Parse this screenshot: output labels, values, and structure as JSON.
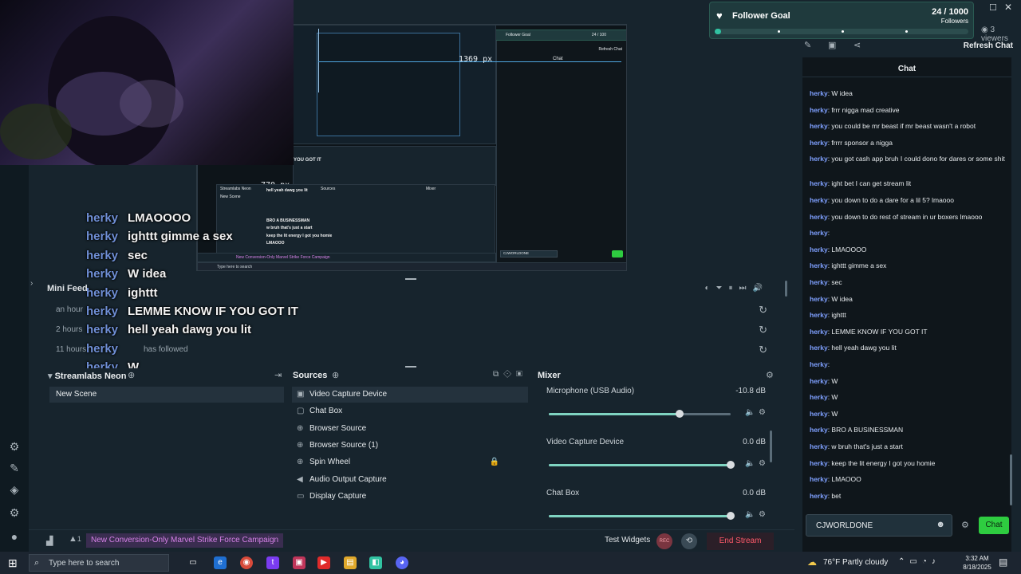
{
  "window": {
    "viewers": "3 viewers"
  },
  "follower_goal": {
    "title": "Follower Goal",
    "count": "24 / 1000",
    "unit": "Followers",
    "progress": 0.024
  },
  "preview": {
    "width_readout": "1369 px",
    "height_readout": "770 px",
    "inner_overlay_line_1": "hell yeah dawg you lit",
    "inner_overlay_line_2": "BRO A BUSINESSMAN",
    "inner_overlay_line_3": "w bruh that's just a start",
    "inner_overlay_line_4": "keep the lit energy I got you homie",
    "inner_overlay_line_5": "LMAOOO",
    "inner_feed_text": "YOU GOT IT",
    "inner_chat_title": "Chat",
    "inner_goal_title": "Follower Goal",
    "inner_goal_count": "24 / 100",
    "inner_refresh": "Refresh Chat",
    "inner_scene": "Streamlabs Neon",
    "inner_new_scene": "New Scene",
    "inner_sources": "Sources",
    "inner_mixer": "Mixer",
    "inner_campaign": "New Conversion-Only Marvel Strike Force Campaign",
    "inner_input": "CJWORLDONE",
    "inner_taskbar_search": "Type here to search"
  },
  "chat_overlay": [
    {
      "user": "herky",
      "msg": "LMAOOOO"
    },
    {
      "user": "herky",
      "msg": "ighttt gimme a sex"
    },
    {
      "user": "herky",
      "msg": "sec"
    },
    {
      "user": "herky",
      "msg": "W idea"
    },
    {
      "user": "herky",
      "msg": "ighttt"
    },
    {
      "user": "herky",
      "msg": "LEMME KNOW IF YOU GOT IT"
    },
    {
      "user": "herky",
      "msg": "hell yeah dawg you lit"
    },
    {
      "user": "herky",
      "msg": ""
    },
    {
      "user": "herky",
      "msg": "W"
    },
    {
      "user": "herky",
      "msg": "W"
    },
    {
      "user": "herky",
      "msg": "W"
    },
    {
      "user": "herky",
      "msg": "BRO A BUSINESSMAN"
    },
    {
      "user": "herky",
      "msg": "w bruh that's just a start"
    },
    {
      "user": "herky",
      "msg": "keep the lit energy I got you\nhomie"
    },
    {
      "user": "herky",
      "msg": "LMAOOO"
    },
    {
      "user": "herky",
      "msg": "bet"
    }
  ],
  "mini_feed": {
    "title": "Mini Feed",
    "rows": [
      {
        "time": "an hour",
        "user": "",
        "action": ""
      },
      {
        "time": "2 hours",
        "user": "",
        "action": ""
      },
      {
        "time": "11 hours",
        "user": "",
        "action": "has followed"
      }
    ]
  },
  "scenes": {
    "title": "Streamlabs Neon",
    "items": [
      "New Scene"
    ]
  },
  "sources": {
    "title": "Sources",
    "items": [
      {
        "label": "Video Capture Device",
        "icon": "video-icon"
      },
      {
        "label": "Chat Box",
        "icon": "chat-icon"
      },
      {
        "label": "Browser Source",
        "icon": "globe-icon"
      },
      {
        "label": "Browser Source (1)",
        "icon": "globe-icon"
      },
      {
        "label": "Spin Wheel",
        "icon": "globe-icon"
      },
      {
        "label": "Audio Output Capture",
        "icon": "speaker-icon"
      },
      {
        "label": "Display Capture",
        "icon": "monitor-icon"
      }
    ]
  },
  "mixer": {
    "title": "Mixer",
    "channels": [
      {
        "name": "Microphone (USB Audio)",
        "db": "-10.8 dB",
        "level": 0.72
      },
      {
        "name": "Video Capture Device",
        "db": "0.0 dB",
        "level": 1.0
      },
      {
        "name": "Chat Box",
        "db": "0.0 dB",
        "level": 1.0
      }
    ]
  },
  "status_bar": {
    "notif_count": "1",
    "campaign": "New Conversion-Only Marvel Strike Force Campaign",
    "test_widgets": "Test Widgets",
    "rec": "REC",
    "end_stream": "End Stream"
  },
  "chat": {
    "title": "Chat",
    "refresh": "Refresh Chat",
    "messages": [
      {
        "user": "herky",
        "msg": "W idea"
      },
      {
        "user": "herky",
        "msg": "frrr nigga mad creative"
      },
      {
        "user": "herky",
        "msg": "you could be mr beast if mr beast wasn't a robot"
      },
      {
        "user": "herky",
        "msg": "frrrr sponsor a nigga"
      },
      {
        "user": "herky",
        "msg": "you got cash app bruh I could dono for dares or some shit"
      },
      {
        "user": "herky",
        "msg": "ight bet I can get stream lit"
      },
      {
        "user": "herky",
        "msg": "you down to do a dare for a lil 5? lmaooo"
      },
      {
        "user": "herky",
        "msg": "you down to do rest of stream in ur boxers lmaooo"
      },
      {
        "user": "herky",
        "msg": ""
      },
      {
        "user": "herky",
        "msg": "LMAOOOO"
      },
      {
        "user": "herky",
        "msg": "ighttt gimme a sex"
      },
      {
        "user": "herky",
        "msg": "sec"
      },
      {
        "user": "herky",
        "msg": "W idea"
      },
      {
        "user": "herky",
        "msg": "ighttt"
      },
      {
        "user": "herky",
        "msg": "LEMME KNOW IF YOU GOT IT"
      },
      {
        "user": "herky",
        "msg": "hell yeah dawg you lit"
      },
      {
        "user": "herky",
        "msg": ""
      },
      {
        "user": "herky",
        "msg": "W"
      },
      {
        "user": "herky",
        "msg": "W"
      },
      {
        "user": "herky",
        "msg": "W"
      },
      {
        "user": "herky",
        "msg": "BRO A BUSINESSMAN"
      },
      {
        "user": "herky",
        "msg": "w bruh that's just a start"
      },
      {
        "user": "herky",
        "msg": "keep the lit energy I got you homie"
      },
      {
        "user": "herky",
        "msg": "LMAOOO"
      },
      {
        "user": "herky",
        "msg": "bet"
      }
    ],
    "input_value": "CJWORLDONE",
    "send_label": "Chat"
  },
  "taskbar": {
    "search_placeholder": "Type here to search",
    "weather": "76°F  Partly cloudy",
    "time": "3:32 AM",
    "date": "8/18/2025"
  },
  "colors": {
    "accent": "#31c3a2",
    "end_stream": "#e84a5f",
    "username": "#7fa0ff",
    "go_live": "#2ecc40"
  }
}
